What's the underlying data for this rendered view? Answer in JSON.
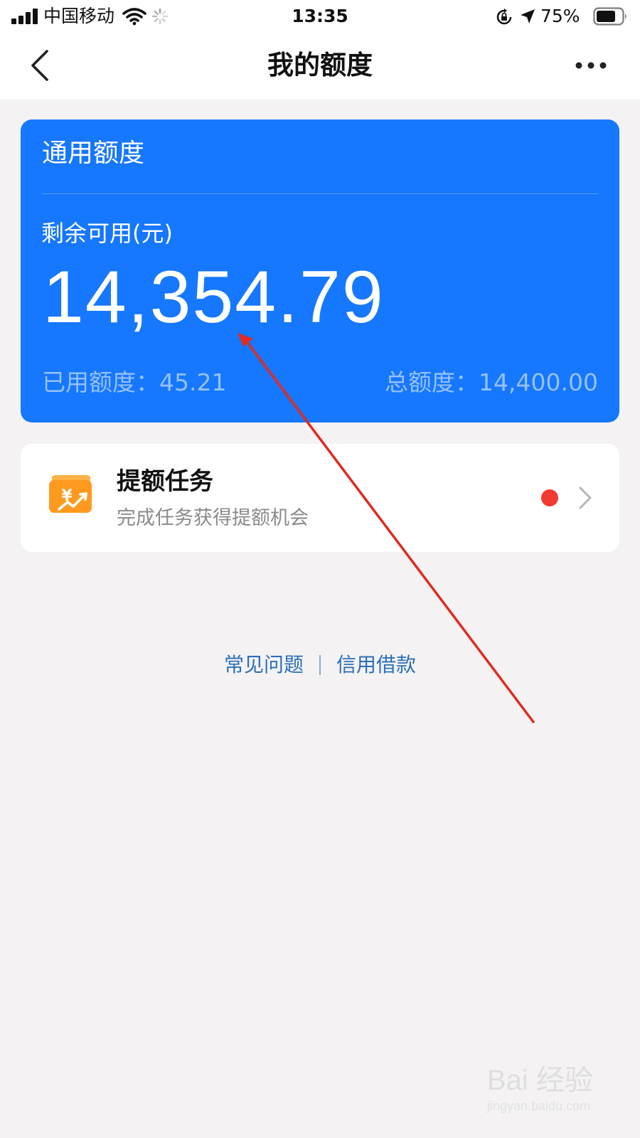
{
  "status_bar": {
    "carrier": "中国移动",
    "time": "13:35",
    "battery": "75%"
  },
  "nav": {
    "title": "我的额度",
    "back_icon": "chevron-left-icon",
    "more_icon": "more-horizontal-icon"
  },
  "quota_card": {
    "title": "通用额度",
    "remaining_label": "剩余可用(元)",
    "remaining_amount": "14,354.79",
    "used_label": "已用额度：45.21",
    "total_label": "总额度：14,400.00",
    "color": "#1677ff"
  },
  "task": {
    "title": "提额任务",
    "subtitle": "完成任务获得提额机会",
    "icon": "yuan-wallet-icon",
    "badge_color": "#f23b30"
  },
  "footer": {
    "faq": "常见问题",
    "credit_loan": "信用借款"
  },
  "watermark": {
    "text": "Bai 经验",
    "url": "jingyan.baidu.com"
  },
  "annotation": {
    "color": "#e02b20"
  }
}
